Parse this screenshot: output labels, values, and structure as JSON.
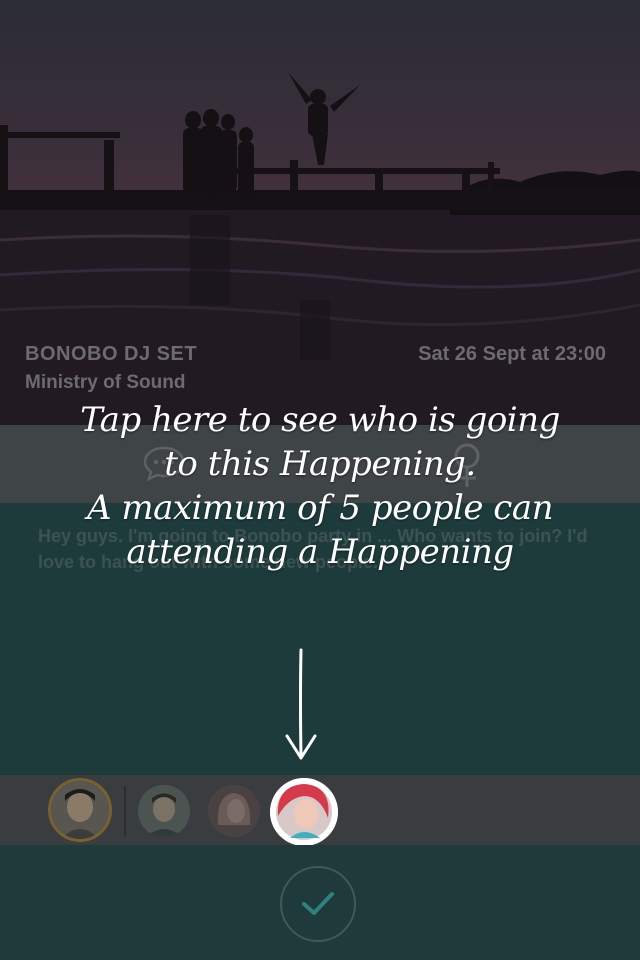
{
  "event": {
    "title": "BONOBO DJ SET",
    "venue": "Ministry of Sound",
    "date": "Sat 26 Sept at 23:00"
  },
  "description": "Hey guys. I'm going to Bonobo party in ... Who wants to join? I'd love to hang out with some new people.",
  "tutorial": {
    "line1": "Tap here to see who is going",
    "line2": "to this Happening.",
    "line3": "A maximum of 5 people can",
    "line4": "attending a Happening"
  },
  "icons": {
    "chat": "chat-bubble-icon",
    "gender": "female-icon",
    "arrow": "arrow-down-icon",
    "confirm": "checkmark-icon"
  },
  "colors": {
    "teal": "#1e3b3b",
    "accent_check": "#2f8080",
    "avatar_ring": "#b8862a"
  }
}
